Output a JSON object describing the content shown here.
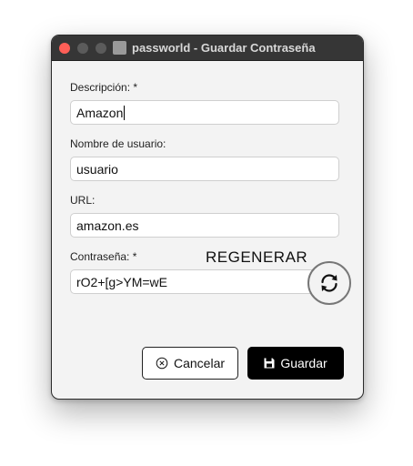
{
  "window": {
    "title": "passworld - Guardar Contraseña"
  },
  "form": {
    "description_label": "Descripción: *",
    "description_value": "Amazon",
    "username_label": "Nombre de usuario:",
    "username_value": "usuario",
    "url_label": "URL:",
    "url_value": "amazon.es",
    "password_label": "Contraseña: *",
    "password_value": "rO2+[g>YM=wE",
    "regenerate_label": "REGENERAR"
  },
  "buttons": {
    "cancel_label": "Cancelar",
    "save_label": "Guardar"
  },
  "icons": {
    "close": "close-traffic-light",
    "minimize": "minimize-traffic-light",
    "maximize": "maximize-traffic-light",
    "app": "app-icon",
    "regenerate": "refresh-icon",
    "cancel": "circle-x-icon",
    "save": "floppy-disk-icon"
  },
  "colors": {
    "titlebar": "#363636",
    "close": "#ff5f57",
    "save_button": "#000000",
    "background": "#f3f3f3"
  }
}
